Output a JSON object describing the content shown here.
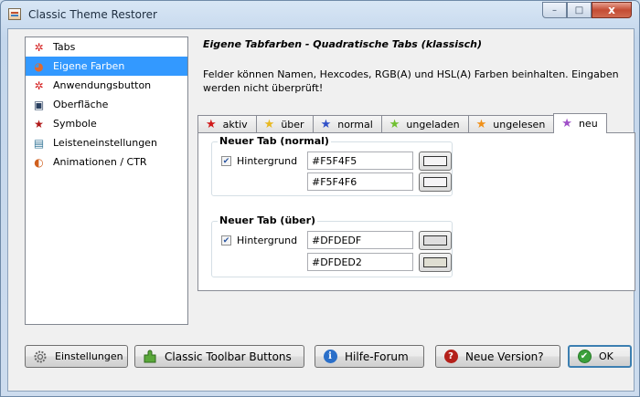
{
  "window": {
    "title": "Classic Theme Restorer"
  },
  "caption": {
    "minimize": "–",
    "maximize": "□",
    "close": "x"
  },
  "nav": {
    "items": [
      {
        "label": "Tabs",
        "icon": "gear-icon",
        "glyph": "✲",
        "color": "#d42020"
      },
      {
        "label": "Eigene Farben",
        "icon": "palette-icon",
        "glyph": "◕",
        "color": "#e06a30"
      },
      {
        "label": "Anwendungsbutton",
        "icon": "gear-icon",
        "glyph": "✲",
        "color": "#d42020"
      },
      {
        "label": "Oberfläche",
        "icon": "window-icon",
        "glyph": "▣",
        "color": "#2a4060"
      },
      {
        "label": "Symbole",
        "icon": "star-icon",
        "glyph": "★",
        "color": "#b01818"
      },
      {
        "label": "Leisteneinstellungen",
        "icon": "toolbar-icon",
        "glyph": "▤",
        "color": "#3a7a9a"
      },
      {
        "label": "Animationen / CTR",
        "icon": "firefox-icon",
        "glyph": "◐",
        "color": "#d0601e"
      }
    ],
    "selected_index": 1
  },
  "content": {
    "heading": "Eigene Tabfarben - Quadratische Tabs (klassisch)",
    "description": "Felder können Namen, Hexcodes, RGB(A) und HSL(A) Farben beinhalten. Eingaben werden nicht überprüft!"
  },
  "tabs": [
    {
      "label": "aktiv",
      "icon": "star-icon",
      "color": "#d01818"
    },
    {
      "label": "über",
      "icon": "star-icon",
      "color": "#e8b820"
    },
    {
      "label": "normal",
      "icon": "star-icon",
      "color": "#3050c8"
    },
    {
      "label": "ungeladen",
      "icon": "star-icon",
      "color": "#70c030"
    },
    {
      "label": "ungelesen",
      "icon": "star-icon",
      "color": "#f09018"
    },
    {
      "label": "neu",
      "icon": "star-icon",
      "color": "#a050c8"
    }
  ],
  "active_tab_index": 5,
  "groups": [
    {
      "title": "Neuer Tab (normal)",
      "checkbox_label": "Hintergrund",
      "checked": true,
      "value1": "#F5F4F5",
      "value2": "#F5F4F6",
      "swatch1": "#F5F4F5",
      "swatch2": "#F5F4F6"
    },
    {
      "title": "Neuer Tab (über)",
      "checkbox_label": "Hintergrund",
      "checked": true,
      "value1": "#DFDEDF",
      "value2": "#DFDED2",
      "swatch1": "#DFDEDF",
      "swatch2": "#DFDED2"
    }
  ],
  "buttons": {
    "settings": "Einstellungen",
    "toolbar": "Classic Toolbar Buttons",
    "forum": "Hilfe-Forum",
    "new_version": "Neue Version?",
    "ok": "OK"
  }
}
